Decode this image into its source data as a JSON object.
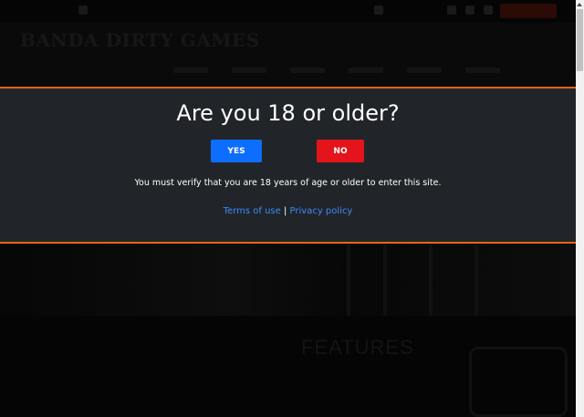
{
  "background": {
    "logo_text": "BANDA DIRTY GAMES",
    "features_heading": "FEATURES"
  },
  "age_gate": {
    "title": "Are you 18 or older?",
    "yes_label": "YES",
    "no_label": "NO",
    "message": "You must verify that you are 18 years of age or older to enter this site.",
    "terms_label": "Terms of use",
    "separator": " | ",
    "privacy_label": "Privacy policy",
    "accent_color": "#e8660d",
    "yes_color": "#0d6efd",
    "no_color": "#e3141b"
  }
}
